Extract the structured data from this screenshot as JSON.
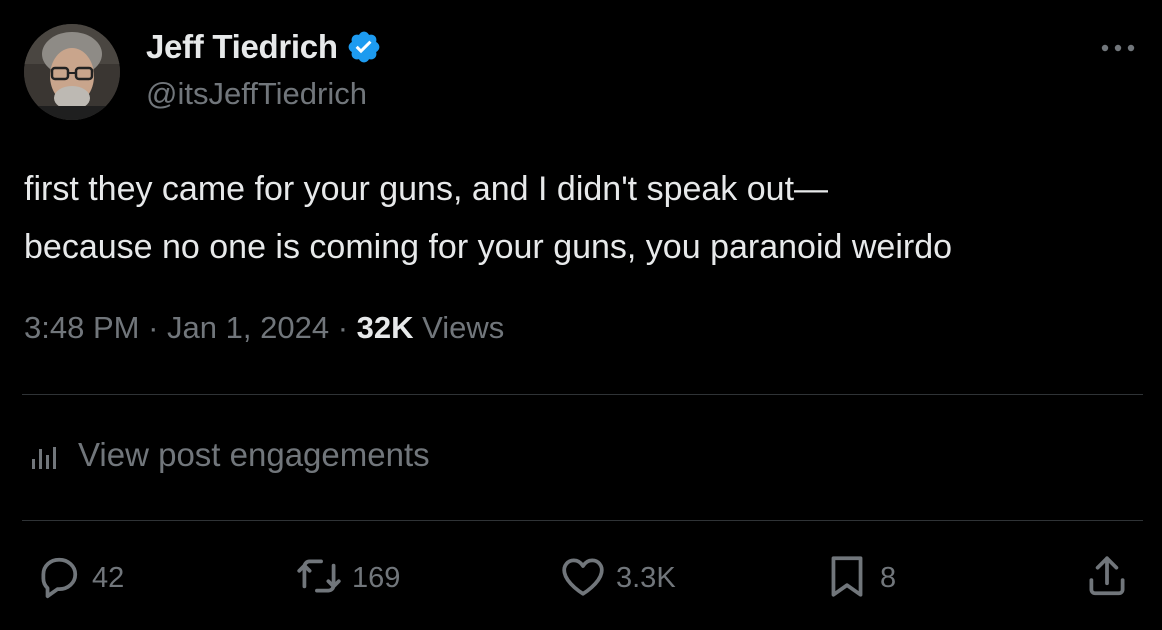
{
  "author": {
    "display_name": "Jeff Tiedrich",
    "handle": "@itsJeffTiedrich",
    "verified_icon": "verified-badge-icon",
    "verified_color": "#1d9bf0"
  },
  "tweet": {
    "text_lines": [
      "first they came for your guns, and I didn't speak out—",
      "because no one is coming for your guns, you paranoid weirdo"
    ],
    "time": "3:48 PM",
    "separator": "·",
    "date": "Jan 1, 2024",
    "views_count": "32K",
    "views_label": "Views"
  },
  "engagements": {
    "label": "View post engagements",
    "icon": "bar-chart-icon"
  },
  "actions": {
    "replies": {
      "icon": "reply-icon",
      "count": "42"
    },
    "reposts": {
      "icon": "repost-icon",
      "count": "169"
    },
    "likes": {
      "icon": "heart-icon",
      "count": "3.3K"
    },
    "bookmarks": {
      "icon": "bookmark-icon",
      "count": "8"
    },
    "share": {
      "icon": "share-icon"
    }
  },
  "more_menu": {
    "icon": "more-horizontal-icon"
  },
  "colors": {
    "background": "#000000",
    "text_primary": "#e7e9ea",
    "text_secondary": "#71767b",
    "divider": "#2f3336",
    "accent": "#1d9bf0"
  }
}
